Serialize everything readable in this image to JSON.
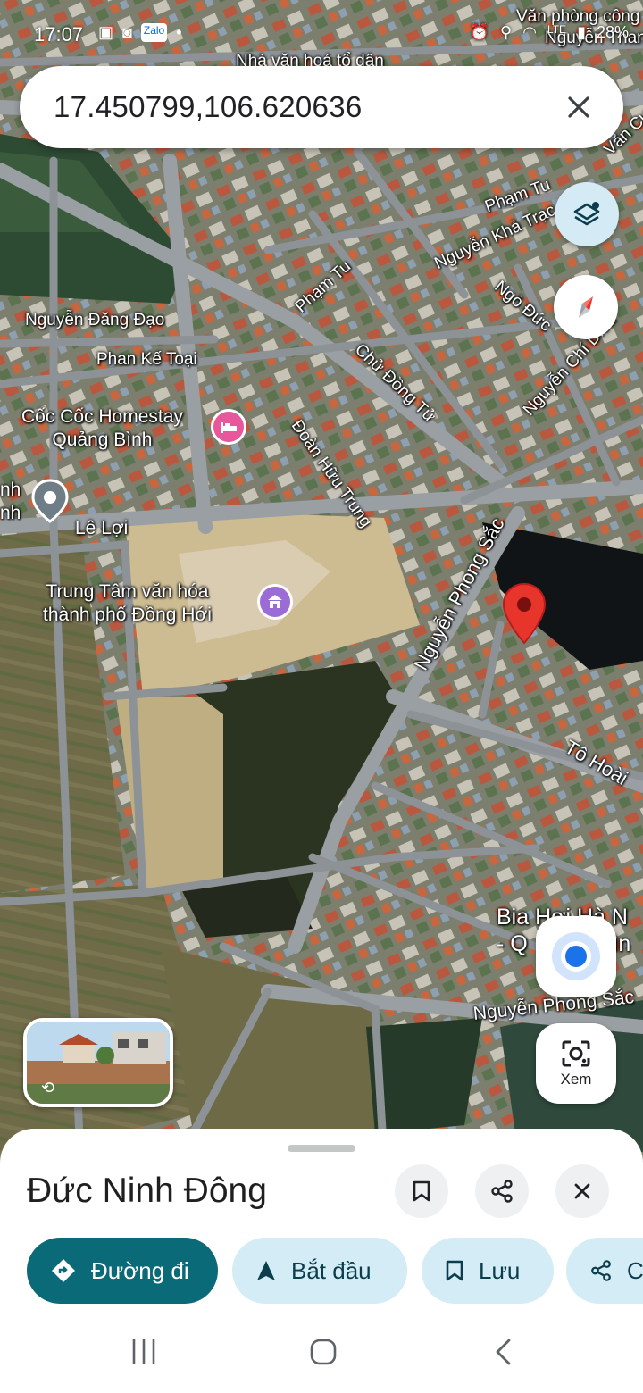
{
  "status_bar": {
    "time": "17:07",
    "battery": "28%",
    "network": "LTE",
    "icons_left": [
      "image-icon",
      "photo-icon",
      "zalo-icon",
      "dot-icon"
    ],
    "icons_right": [
      "alarm-icon",
      "location-icon",
      "wifi-icon",
      "signal-icon",
      "battery-icon"
    ]
  },
  "search": {
    "query": "17.450799,106.620636",
    "clear_icon": "close-icon"
  },
  "map": {
    "type": "satellite",
    "street_labels": [
      "Phạm Tu",
      "Nguyễn Khả Trạc",
      "Ngô Đức",
      "Nguyễn Chí Diểu",
      "Phạm Tu",
      "Chử Đồng Tử",
      "Đoàn Hữu Trung",
      "Nguyễn Đăng Đạo",
      "Phan Kế Toại",
      "Lê Lợi",
      "Nguyễn Phong Sắc",
      "Tô Hoài",
      "Nguyễn Phong Sắc",
      "Văn Cụ",
      "Nhà văn hoá tổ dân",
      "Văn phòng công",
      "Nguyễn Than"
    ],
    "pois": {
      "homestay": {
        "line1": "Cốc Cốc Homestay",
        "line2": "Quảng Bình",
        "icon": "bed-icon",
        "color": "#e8579b"
      },
      "culture_center": {
        "line1": "Trung Tâm văn hóa",
        "line2": "thành phố Đồng Hới",
        "icon": "landmark-icon",
        "color": "#9b6bd6"
      },
      "left_poi": {
        "line1": "nh",
        "line2": "nh",
        "icon": "place-icon",
        "color": "#6f7d86"
      },
      "bia_hoi": {
        "line1": "Bia Hơi Hà N",
        "line2": "- Q",
        "line3": "Bìn"
      }
    },
    "pin_color": "#e8352c"
  },
  "controls": {
    "layers_icon": "layers-icon",
    "compass_icon": "compass-icon",
    "my_location_icon": "my-location-icon",
    "lens_label": "Xem"
  },
  "place": {
    "name": "Đức Ninh Đông",
    "actions": {
      "directions": "Đường đi",
      "start": "Bắt đầu",
      "save": "Lưu",
      "share": "C"
    }
  },
  "nav_bar": {
    "icons": [
      "recents-icon",
      "home-icon",
      "back-icon"
    ]
  }
}
